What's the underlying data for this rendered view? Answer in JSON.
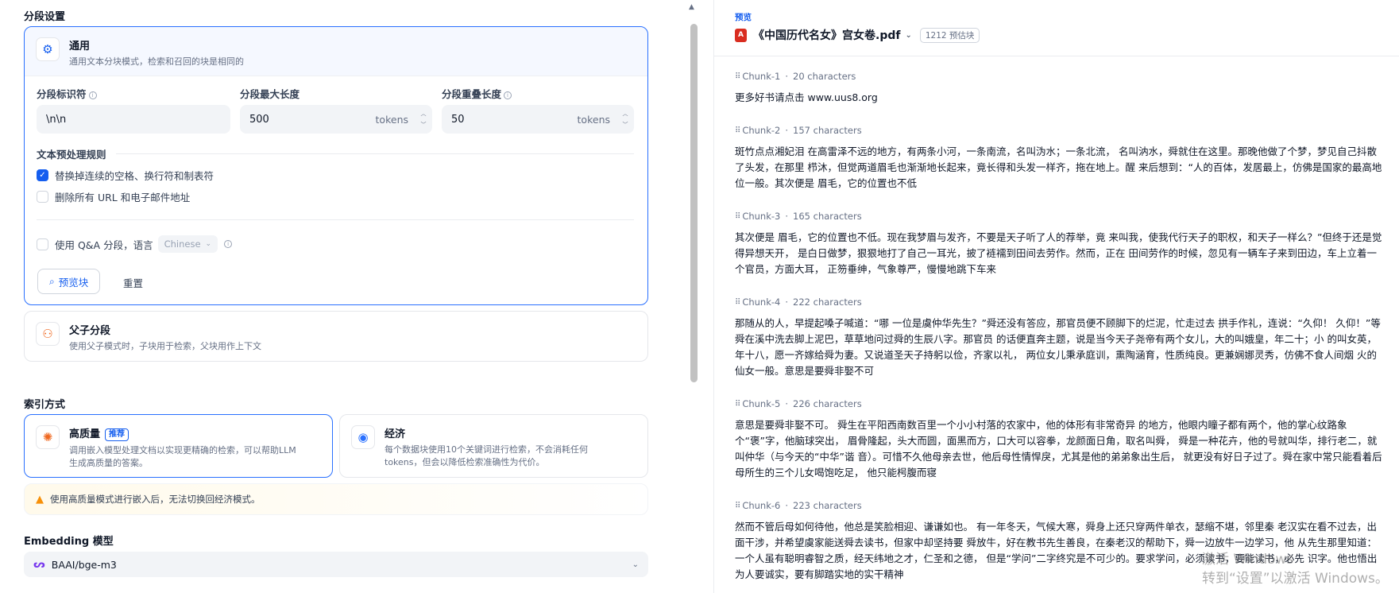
{
  "segmentation": {
    "section_title": "分段设置",
    "general": {
      "title": "通用",
      "desc": "通用文本分块模式，检索和召回的块是相同的",
      "identifier_label": "分段标识符",
      "identifier_value": "\\n\\n",
      "max_length_label": "分段最大长度",
      "max_length_value": "500",
      "max_length_unit": "tokens",
      "overlap_label": "分段重叠长度",
      "overlap_value": "50",
      "overlap_unit": "tokens",
      "rules_title": "文本预处理规则",
      "rule_1": "替换掉连续的空格、换行符和制表符",
      "rule_1_checked": true,
      "rule_2": "删除所有 URL 和电子邮件地址",
      "rule_2_checked": false,
      "qa_label": "使用 Q&A 分段，语言",
      "qa_language": "Chinese",
      "preview_button": "预览块",
      "reset_button": "重置"
    },
    "parent_child": {
      "title": "父子分段",
      "desc": "使用父子模式时，子块用于检索，父块用作上下文"
    }
  },
  "index": {
    "section_title": "索引方式",
    "high_quality": {
      "title": "高质量",
      "badge": "推荐",
      "desc_line1": "调用嵌入模型处理文档以实现更精确的检索，可以帮助LLM",
      "desc_line2": "生成高质量的答案。"
    },
    "economy": {
      "title": "经济",
      "desc_line1": "每个数据块使用10个关键词进行检索，不会消耗任何",
      "desc_line2": "tokens，但会以降低检索准确性为代价。"
    },
    "warning": "使用高质量模式进行嵌入后，无法切换回经济模式。"
  },
  "embedding": {
    "section_title": "Embedding 模型",
    "model": "BAAI/bge-m3"
  },
  "preview": {
    "label": "预览",
    "file_name": "《中国历代名女》宫女卷.pdf",
    "block_count": "1212 预估块",
    "chunks": [
      {
        "id": "Chunk-1",
        "chars": "20 characters",
        "text": "更多好书请点击 www.uus8.org"
      },
      {
        "id": "Chunk-2",
        "chars": "157 characters",
        "text": "斑竹点点湘妃泪 在高雷泽不远的地方，有两条小河，一条南流，名叫沩水；一条北流， 名叫汭水，舜就住在这里。那晚他做了个梦，梦见自己抖散了头发，在那里 栉沐，但觉两道眉毛也渐渐地长起来，竟长得和头发一样齐，拖在地上。醒 来后想到：“人的百体，发居最上，仿佛是国家的最高地位一般。其次便是 眉毛，它的位置也不低"
      },
      {
        "id": "Chunk-3",
        "chars": "165 characters",
        "text": "其次便是 眉毛，它的位置也不低。现在我梦眉与发齐，不要是天子听了人的荐举，竟 来叫我，使我代行天子的职权，和天子一样么？”但终于还是觉得异想天开， 是白日做梦，狠狠地打了自己一耳光，披了裢襦到田间去劳作。然而，正在 田间劳作的时候，忽见有一辆车子来到田边，车上立着一个官员，方面大耳， 正笏垂绅，气象尊严，慢慢地跳下车来"
      },
      {
        "id": "Chunk-4",
        "chars": "222 characters",
        "text": "那随从的人，早提起嗓子喊道：“哪 一位是虞仲华先生？”舜还没有答应，那官员便不顾脚下的烂泥，忙走过去 拱手作礼，连说：“久仰！ 久仰！”等舜在溪中洗去脚上泥巴，草草地问过舜的生辰八字。那官员 的话便直奔主题，说是当今天子尧帝有两个女儿，大的叫娥皇，年二十；小 的叫女英，年十八，愿一齐嫁给舜为妻。又说道圣天子持躬以俭，齐家以礼， 两位女儿秉承庭训，熏陶涵育，性质纯良。更兼娴娜灵秀，仿佛不食人间烟 火的仙女一般。意思是要舜非娶不可"
      },
      {
        "id": "Chunk-5",
        "chars": "226 characters",
        "text": "意思是要舜非娶不可。 舜生在平阳西南数百里一个小小村落的农家中，他的体形有非常奇异 的地方，他眼内瞳子都有两个，他的掌心纹路象个“褒”字，他脑球突出， 眉骨隆起，头大而圆，面黑而方，口大可以容拳，龙颜面日角，取名叫舜， 舜是一种花卉，他的号就叫华，排行老二，就叫仲华（与今天的“中华”谐 音）。可惜不久他母亲去世，他后母性情悍戾，尤其是他的弟弟象出生后， 就更没有好日子过了。舜在家中常只能看着后母所生的三个儿女喝饱吃足， 他只能枵腹而寝"
      },
      {
        "id": "Chunk-6",
        "chars": "223 characters",
        "text": "然而不管后母如何待他，他总是笑脸相迎、谦谦如也。 有一年冬天，气候大寒，舜身上还只穿两件单衣，瑟缩不堪，邻里秦 老汉实在看不过去，出面干涉，并希望虞家能送舜去读书，但家中却坚持要 舜放牛，好在教书先生善良，在秦老汉的帮助下，舜一边放牛一边学习，他 从先生那里知道：一个人虽有聪明睿智之质，经天纬地之才，仁圣和之德， 但是“学问”二字终究是不可少的。要求学问，必须读书，要能读书，必先 识字。他也悟出为人要诚实，要有脚踏实地的实干精神"
      }
    ]
  },
  "watermark": {
    "line1": "激活 Windows",
    "line2": "转到“设置”以激活 Windows。"
  }
}
